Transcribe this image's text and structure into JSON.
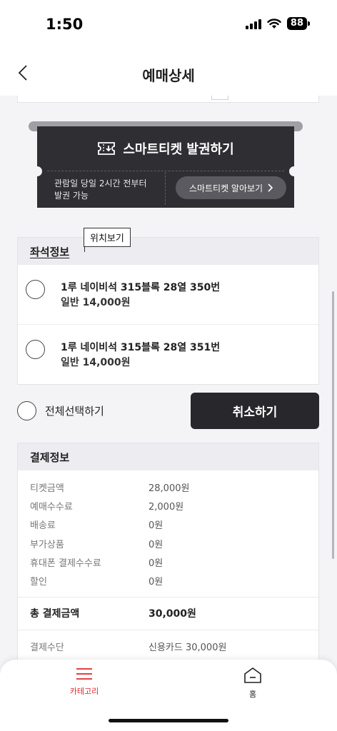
{
  "status": {
    "time": "1:50",
    "battery": "88"
  },
  "header": {
    "title": "예매상세"
  },
  "smart_ticket": {
    "title": "스마트티켓 발권하기",
    "desc_line1": "관람일 당일 2시간 전부터",
    "desc_line2": "발권 가능",
    "link_label": "스마트티켓 알아보기"
  },
  "seat_info": {
    "heading": "좌석정보",
    "tooltip": "위치보기",
    "seats": [
      {
        "seat": "1루 네이비석 315블록 28열 350번",
        "price": "일반 14,000원"
      },
      {
        "seat": "1루 네이비석 315블록 28열 351번",
        "price": "일반 14,000원"
      }
    ]
  },
  "actions": {
    "select_all": "전체선택하기",
    "cancel": "취소하기"
  },
  "payment": {
    "heading": "결제정보",
    "rows": [
      {
        "label": "티켓금액",
        "value": "28,000원"
      },
      {
        "label": "예매수수료",
        "value": "2,000원"
      },
      {
        "label": "배송료",
        "value": "0원"
      },
      {
        "label": "부가상품",
        "value": "0원"
      },
      {
        "label": "휴대폰 결제수수료",
        "value": "0원"
      },
      {
        "label": "할인",
        "value": "0원"
      }
    ],
    "total_label": "총 결제금액",
    "total_value": "30,000원",
    "method_label": "결제수단",
    "method_value": "신용카드 30,000원"
  },
  "nav": {
    "category": "카테고리",
    "home": "홈"
  },
  "colors": {
    "accent": "#e0262c",
    "dark": "#27272c",
    "ticket": "#2e2e33"
  }
}
